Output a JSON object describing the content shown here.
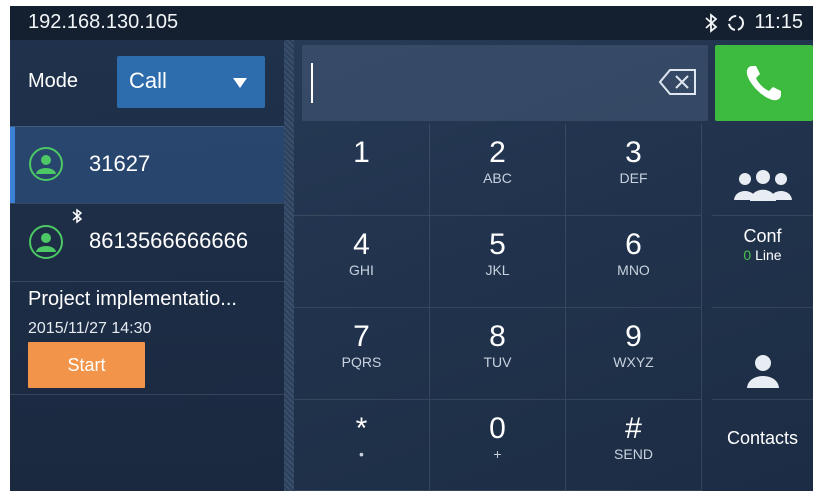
{
  "statusbar": {
    "ip": "192.168.130.105",
    "time": "11:15",
    "icons": [
      "bluetooth-icon",
      "sync-icon"
    ]
  },
  "mode": {
    "label": "Mode",
    "value": "Call"
  },
  "call_list": [
    {
      "number": "31627",
      "icon": "contact-avatar-icon",
      "selected": true
    },
    {
      "number": "8613566666666",
      "icon": "contact-avatar-icon",
      "bluetooth": true,
      "selected": false
    }
  ],
  "meeting": {
    "title": "Project implementatio...",
    "datetime": "2015/11/27 14:30",
    "start_label": "Start"
  },
  "dial_input": {
    "value": ""
  },
  "keypad": [
    {
      "digit": "1",
      "letters": ""
    },
    {
      "digit": "2",
      "letters": "ABC"
    },
    {
      "digit": "3",
      "letters": "DEF"
    },
    {
      "digit": "4",
      "letters": "GHI"
    },
    {
      "digit": "5",
      "letters": "JKL"
    },
    {
      "digit": "6",
      "letters": "MNO"
    },
    {
      "digit": "7",
      "letters": "PQRS"
    },
    {
      "digit": "8",
      "letters": "TUV"
    },
    {
      "digit": "9",
      "letters": "WXYZ"
    },
    {
      "digit": "*",
      "letters": "•"
    },
    {
      "digit": "0",
      "letters": "+"
    },
    {
      "digit": "#",
      "letters": "SEND"
    }
  ],
  "side": {
    "conf_label": "Conf",
    "conf_count": "0",
    "conf_suffix": " Line",
    "contacts_label": "Contacts"
  },
  "colors": {
    "call_green": "#3dbb3f",
    "mode_blue": "#2d6cad",
    "start_orange": "#f2954a",
    "avatar_green": "#4cc864",
    "selected_bar": "#3b82d6"
  }
}
